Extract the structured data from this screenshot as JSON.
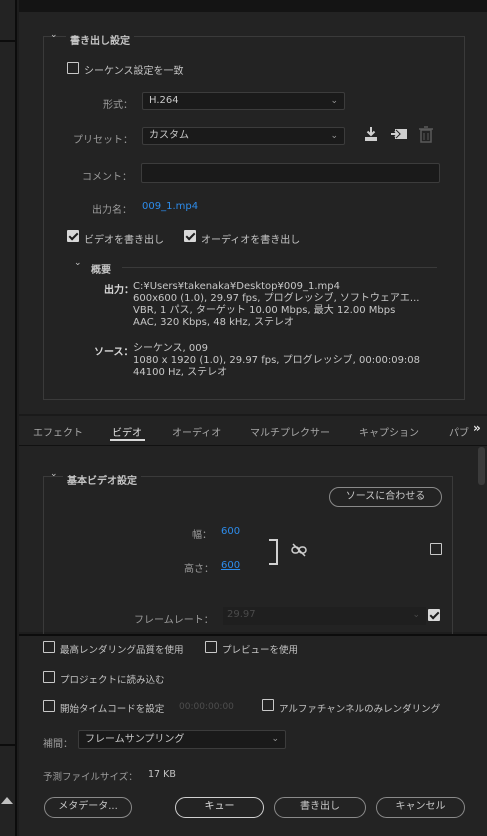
{
  "export_settings": {
    "section_title": "書き出し設定",
    "match_sequence": "シーケンス設定を一致",
    "format_label": "形式：",
    "format_value": "H.264",
    "preset_label": "プリセット：",
    "preset_value": "カスタム",
    "comment_label": "コメント：",
    "comment_value": "",
    "output_label": "出力名：",
    "output_value": "009_1.mp4",
    "export_video": "ビデオを書き出し",
    "export_audio": "オーディオを書き出し",
    "summary_title": "概要",
    "output_key": "出力：",
    "output_lines": [
      "C:¥Users¥takenaka¥Desktop¥009_1.mp4",
      "600x600 (1.0), 29.97 fps, プログレッシブ, ソフトウェアエ...",
      "VBR, 1 パス, ターゲット 10.00 Mbps, 最大 12.00 Mbps",
      "AAC, 320 Kbps, 48 kHz, ステレオ"
    ],
    "source_key": "ソース：",
    "source_lines": [
      "シーケンス, 009",
      "1080 x 1920 (1.0), 29.97 fps, プログレッシブ, 00:00:09:08",
      "44100 Hz, ステレオ"
    ]
  },
  "tabs": [
    "エフェクト",
    "ビデオ",
    "オーディオ",
    "マルチプレクサー",
    "キャプション",
    "パブ"
  ],
  "tabs_more": "»",
  "video": {
    "section_title": "基本ビデオ設定",
    "match_source": "ソースに合わせる",
    "width_label": "幅：",
    "width_value": "600",
    "height_label": "高さ：",
    "height_value": "600",
    "framerate_label": "フレームレート：",
    "framerate_value": "29.97"
  },
  "bottom": {
    "max_quality": "最高レンダリング品質を使用",
    "use_preview": "プレビューを使用",
    "import_project": "プロジェクトに読み込む",
    "set_timecode": "開始タイムコードを設定",
    "timecode_value": "00:00:00:00",
    "alpha_only": "アルファチャンネルのみレンダリング",
    "interp_label": "補間：",
    "interp_value": "フレームサンプリング",
    "filesize_label": "予測ファイルサイズ：",
    "filesize_value": "17 KB",
    "metadata_btn": "メタデータ...",
    "queue_btn": "キュー",
    "export_btn": "書き出し",
    "cancel_btn": "キャンセル"
  },
  "colors": {
    "accent_blue": "#2d8ceb",
    "panel_bg": "#232323",
    "dark_bg": "#1d1d1d"
  }
}
